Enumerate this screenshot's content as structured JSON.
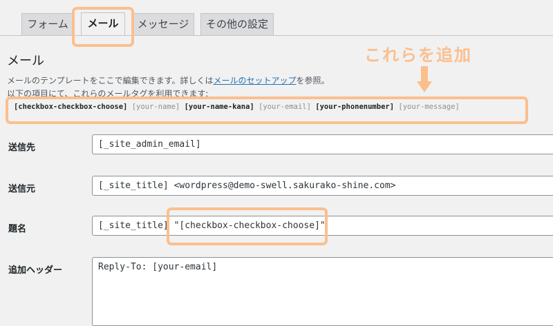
{
  "tabs": [
    {
      "label": "フォーム",
      "active": false
    },
    {
      "label": "メール",
      "active": true
    },
    {
      "label": "メッセージ",
      "active": false
    },
    {
      "label": "その他の設定",
      "active": false
    }
  ],
  "annotation": {
    "text": "これらを追加",
    "color": "#fbbf8e"
  },
  "mail": {
    "title": "メール",
    "desc_prefix": "メールのテンプレートをここで編集できます。詳しくは",
    "desc_link": "メールのセットアップ",
    "desc_suffix": "を参照。",
    "desc_line2": "以下の項目にて、これらのメールタグを利用できます:",
    "tags": [
      {
        "text": "[checkbox-checkbox-choose]",
        "used": true
      },
      {
        "text": "[your-name]",
        "used": false
      },
      {
        "text": "[your-name-kana]",
        "used": true
      },
      {
        "text": "[your-email]",
        "used": false
      },
      {
        "text": "[your-phonenumber]",
        "used": true
      },
      {
        "text": "[your-message]",
        "used": false
      }
    ]
  },
  "fields": {
    "to": {
      "label": "送信先",
      "value": "[_site_admin_email]"
    },
    "from": {
      "label": "送信元",
      "value": "[_site_title] <wordpress@demo-swell.sakurako-shine.com>"
    },
    "subject": {
      "label": "題名",
      "value": "[_site_title] \"[checkbox-checkbox-choose]\""
    },
    "headers": {
      "label": "追加ヘッダー",
      "value": "Reply-To: [your-email]"
    }
  }
}
